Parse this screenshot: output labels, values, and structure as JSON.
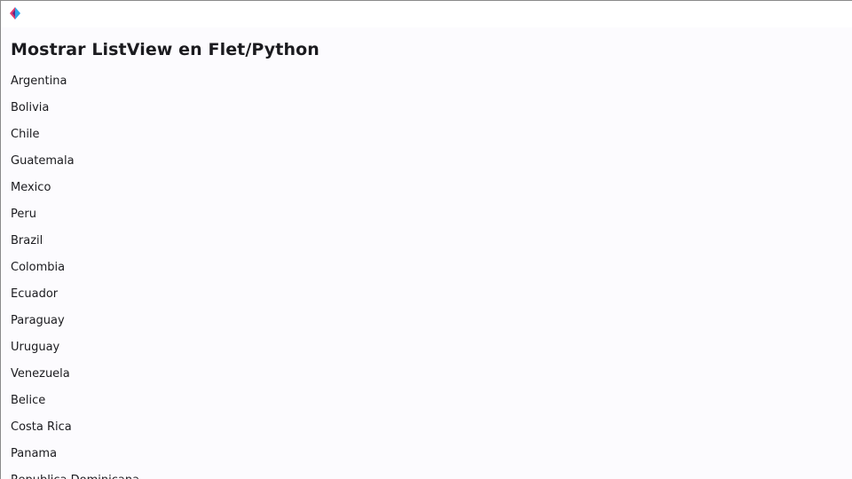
{
  "app": {
    "icon": "flet-logo-icon",
    "colors": {
      "logo_pink": "#e23a6e",
      "logo_blue": "#2fa3e6",
      "logo_dark": "#5b2a86",
      "background": "#fcfbfe",
      "titlebar": "#ffffff",
      "text": "#1b1b1f"
    }
  },
  "main": {
    "title": "Mostrar ListView en Flet/Python",
    "countries": [
      "Argentina",
      "Bolivia",
      "Chile",
      "Guatemala",
      "Mexico",
      "Peru",
      "Brazil",
      "Colombia",
      "Ecuador",
      "Paraguay",
      "Uruguay",
      "Venezuela",
      "Belice",
      "Costa Rica",
      "Panama",
      "Republica Dominicana"
    ]
  }
}
